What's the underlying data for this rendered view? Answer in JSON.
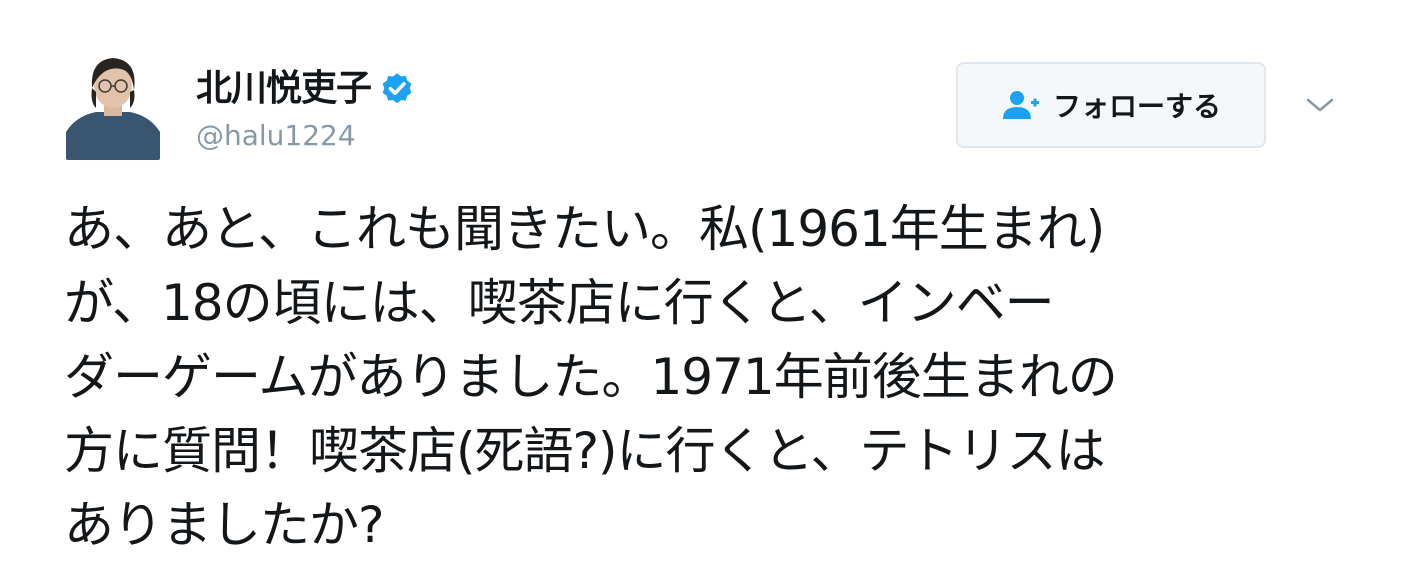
{
  "user": {
    "display_name": "北川悦吏子",
    "handle": "@halu1224"
  },
  "follow_button": {
    "label": "フォローする"
  },
  "tweet": {
    "lines": [
      "あ、あと、これも聞きたい。私(1961年生まれ)",
      "が、18の頃には、喫茶店に行くと、インベー",
      "ダーゲームがありました。1971年前後生まれの",
      "方に質問！喫茶店(死語?)に行くと、テトリスは",
      "ありましたか?"
    ]
  },
  "icons": {
    "avatar": "avatar-photo",
    "verified": "verified-badge-icon",
    "follow": "person-plus-icon",
    "menu": "chevron-down-icon"
  },
  "colors": {
    "verified": "#1da1f2",
    "follow_icon": "#1da1f2",
    "text": "#14171a",
    "handle": "#8899a6"
  }
}
